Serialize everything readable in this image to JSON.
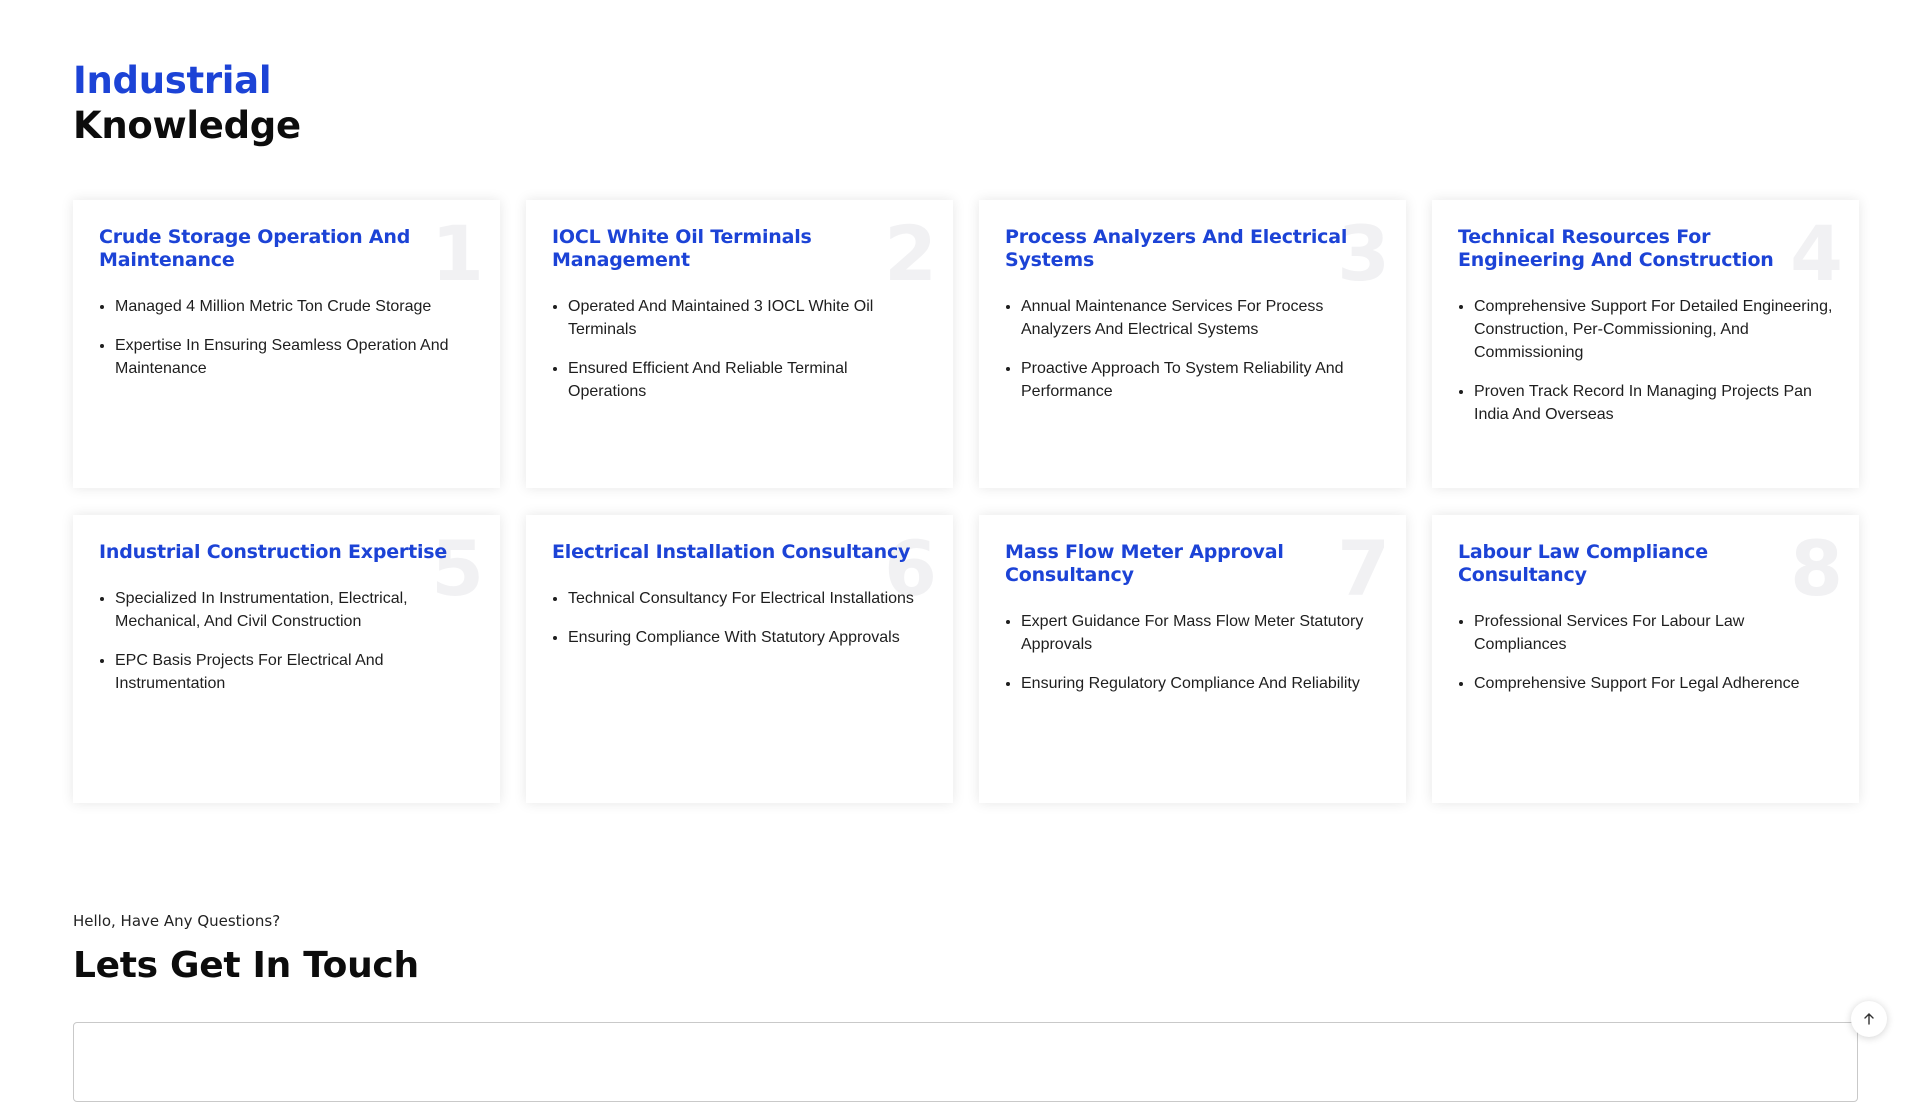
{
  "header": {
    "title_accent": "Industrial",
    "title_main": "Knowledge"
  },
  "cards": [
    {
      "number": "1",
      "title": "Crude Storage Operation And Maintenance",
      "points": [
        "Managed 4 Million Metric Ton Crude Storage",
        "Expertise In Ensuring Seamless Operation And Maintenance"
      ]
    },
    {
      "number": "2",
      "title": "IOCL White Oil Terminals Management",
      "points": [
        "Operated And Maintained 3 IOCL White Oil Terminals",
        "Ensured Efficient And Reliable Terminal Operations"
      ]
    },
    {
      "number": "3",
      "title": "Process Analyzers And Electrical Systems",
      "points": [
        "Annual Maintenance Services For Process Analyzers And Electrical Systems",
        "Proactive Approach To System Reliability And Performance"
      ]
    },
    {
      "number": "4",
      "title": "Technical Resources For Engineering And Construction",
      "points": [
        "Comprehensive Support For Detailed Engineering, Construction, Per-Commissioning, And Commissioning",
        "Proven Track Record In Managing Projects Pan India And Overseas"
      ]
    },
    {
      "number": "5",
      "title": "Industrial Construction Expertise",
      "points": [
        "Specialized In Instrumentation, Electrical, Mechanical, And Civil Construction",
        "EPC Basis Projects For Electrical And Instrumentation"
      ]
    },
    {
      "number": "6",
      "title": "Electrical Installation Consultancy",
      "points": [
        "Technical Consultancy For Electrical Installations",
        "Ensuring Compliance With Statutory Approvals"
      ]
    },
    {
      "number": "7",
      "title": "Mass Flow Meter Approval Consultancy",
      "points": [
        "Expert Guidance For Mass Flow Meter Statutory Approvals",
        "Ensuring Regulatory Compliance And Reliability"
      ]
    },
    {
      "number": "8",
      "title": "Labour Law Compliance Consultancy",
      "points": [
        "Professional Services For Labour Law Compliances",
        "Comprehensive Support For Legal Adherence"
      ]
    }
  ],
  "contact": {
    "kicker": "Hello, Have Any Questions?",
    "title": "Lets Get In Touch"
  },
  "scroll_top": {
    "icon": "arrow-up-icon"
  },
  "colors": {
    "accent": "#1c43d6",
    "heading": "#0c0c0c",
    "card_number": "#f1f1f3"
  }
}
